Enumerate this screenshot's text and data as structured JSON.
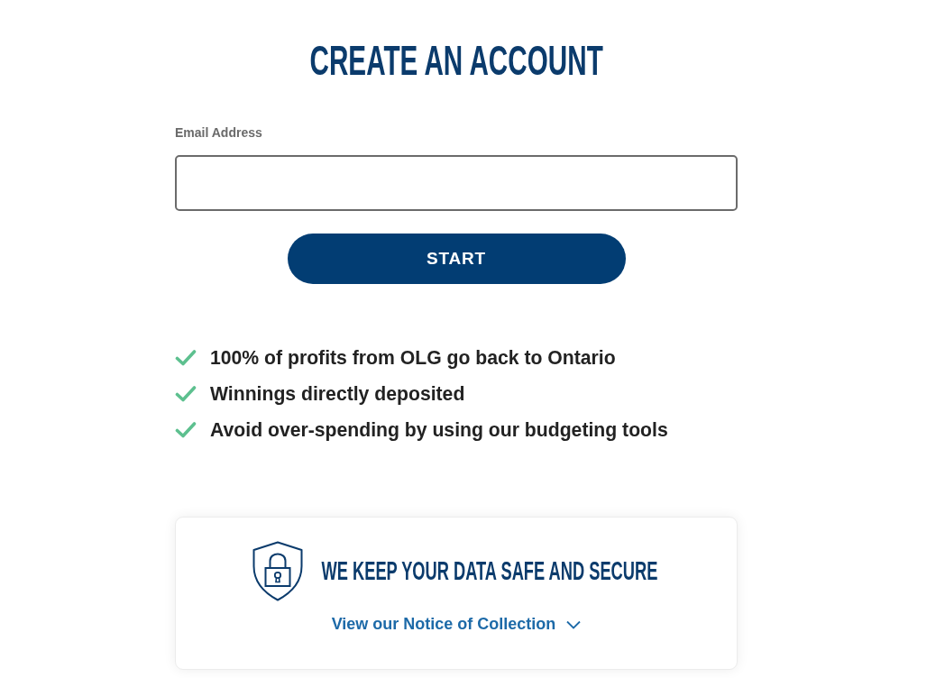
{
  "title": "CREATE AN ACCOUNT",
  "email_field": {
    "label": "Email Address"
  },
  "start_button": "START",
  "benefits": [
    "100% of profits from OLG go back to Ontario",
    "Winnings directly deposited",
    "Avoid over-spending by using our budgeting tools"
  ],
  "security_card": {
    "title": "WE KEEP YOUR DATA SAFE AND SECURE",
    "link": "View our Notice of Collection",
    "expanded": false
  }
}
